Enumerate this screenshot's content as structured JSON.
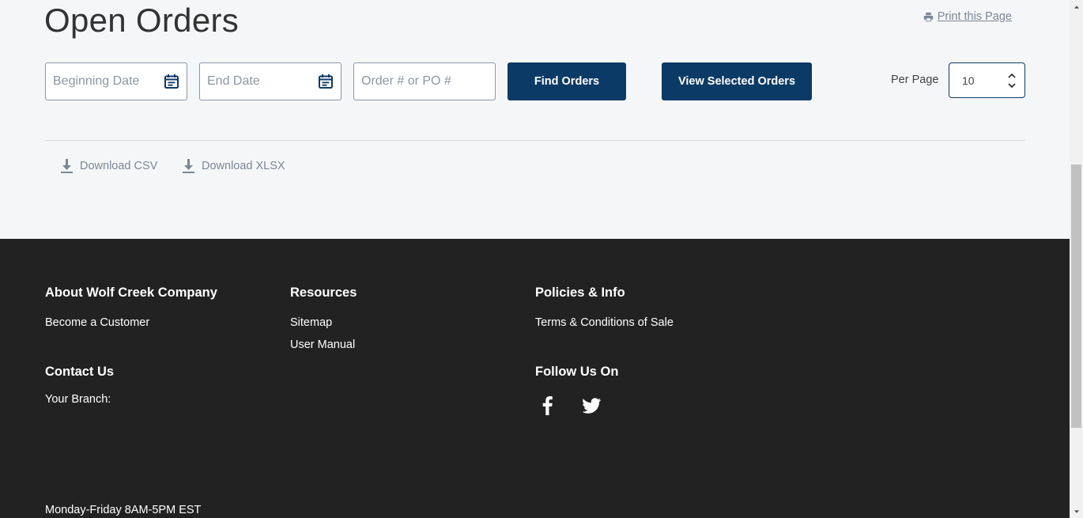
{
  "header": {
    "title": "Open Orders",
    "print_label": "Print this Page"
  },
  "filters": {
    "begin_placeholder": "Beginning Date",
    "end_placeholder": "End Date",
    "order_placeholder": "Order # or PO #",
    "find_label": "Find Orders",
    "view_selected_label": "View Selected Orders",
    "per_page_label": "Per Page",
    "per_page_value": "10"
  },
  "downloads": {
    "csv_label": "Download CSV",
    "xlsx_label": "Download XLSX"
  },
  "footer": {
    "about": {
      "heading": "About Wolf Creek Company",
      "links": [
        "Become a Customer"
      ]
    },
    "resources": {
      "heading": "Resources",
      "links": [
        "Sitemap",
        "User Manual"
      ]
    },
    "policies": {
      "heading": "Policies & Info",
      "links": [
        "Terms & Conditions of Sale"
      ]
    },
    "contact": {
      "heading": "Contact Us",
      "branch_label": "Your Branch:",
      "hours": "Monday-Friday 8AM-5PM EST"
    },
    "follow": {
      "heading": "Follow Us On",
      "icons": [
        "facebook-icon",
        "twitter-icon"
      ]
    }
  },
  "colors": {
    "primary": "#0b3a66",
    "footer_bg": "#222222",
    "page_bg": "#f5f6f8",
    "muted_link": "#7b8796"
  }
}
